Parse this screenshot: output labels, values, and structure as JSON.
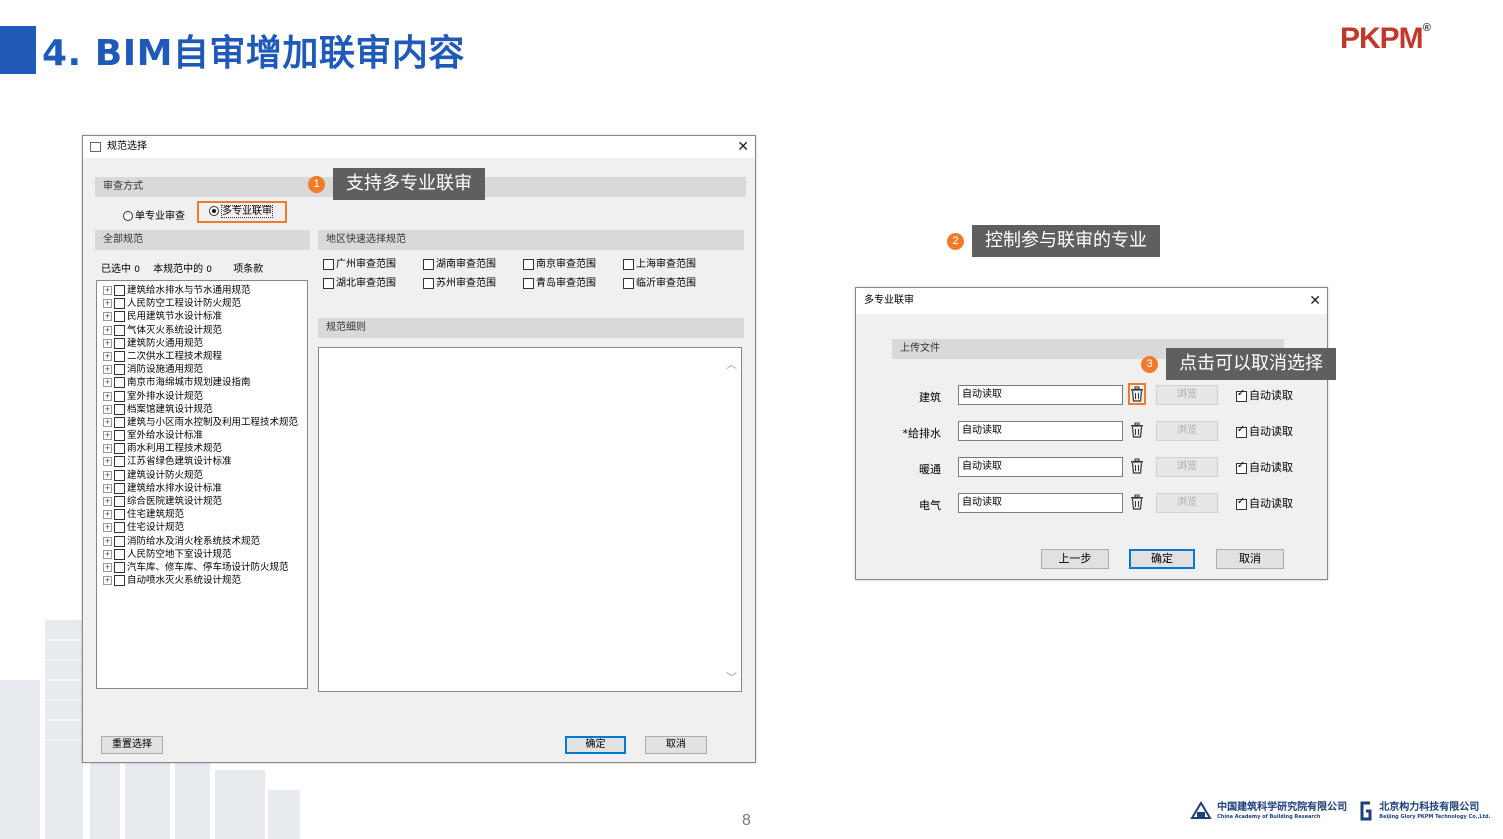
{
  "slide": {
    "title": "4. BIM自审增加联审内容",
    "logo": "PKPM",
    "logo_reg": "®",
    "page_number": "8",
    "footer": {
      "org1_name": "中国建筑科学研究院有限公司",
      "org1_en": "China Academy of Building Research",
      "org2_name": "北京构力科技有限公司",
      "org2_en": "Beijing Glory PKPM Technology Co.,Ltd."
    }
  },
  "callouts": {
    "c1": {
      "badge": "1",
      "text": "支持多专业联审"
    },
    "c2": {
      "badge": "2",
      "text": "控制参与联审的专业"
    },
    "c3": {
      "badge": "3",
      "text": "点击可以取消选择"
    }
  },
  "spec_dialog": {
    "title": "规范选择",
    "review_mode_header": "审查方式",
    "mode_single": "单专业审查",
    "mode_multi": "多专业联审",
    "all_specs_header": "全部规范",
    "selected_label": "已选中",
    "selected_count": "0",
    "in_spec_label": "本规范中的",
    "in_spec_count": "0",
    "items_label": "项条款",
    "specs": [
      "建筑给水排水与节水通用规范",
      "人民防空工程设计防火规范",
      "民用建筑节水设计标准",
      "气体灭火系统设计规范",
      "建筑防火通用规范",
      "二次供水工程技术规程",
      "消防设施通用规范",
      "南京市海绵城市规划建设指南",
      "室外排水设计规范",
      "档案馆建筑设计规范",
      "建筑与小区雨水控制及利用工程技术规范",
      "室外给水设计标准",
      "雨水利用工程技术规范",
      "江苏省绿色建筑设计标准",
      "建筑设计防火规范",
      "建筑给水排水设计标准",
      "综合医院建筑设计规范",
      "住宅建筑规范",
      "住宅设计规范",
      "消防给水及消火栓系统技术规范",
      "人民防空地下室设计规范",
      "汽车库、修车库、停车场设计防火规范",
      "自动喷水灭火系统设计规范"
    ],
    "region_header": "地区快速选择规范",
    "regions": [
      "广州审查范围",
      "湖南审查范围",
      "南京审查范围",
      "上海审查范围",
      "湖北审查范围",
      "苏州审查范围",
      "青岛审查范围",
      "临沂审查范围"
    ],
    "detail_header": "规范细则",
    "reset_button": "重置选择",
    "ok_button": "确定",
    "cancel_button": "取消"
  },
  "multi_dialog": {
    "title": "多专业联审",
    "upload_header": "上传文件",
    "rows": [
      {
        "label": "建筑",
        "value": "自动读取",
        "browse": "浏览",
        "auto": "自动读取"
      },
      {
        "label": "*给排水",
        "value": "自动读取",
        "browse": "浏览",
        "auto": "自动读取"
      },
      {
        "label": "暖通",
        "value": "自动读取",
        "browse": "浏览",
        "auto": "自动读取"
      },
      {
        "label": "电气",
        "value": "自动读取",
        "browse": "浏览",
        "auto": "自动读取"
      }
    ],
    "prev_button": "上一步",
    "ok_button": "确定",
    "cancel_button": "取消"
  },
  "colors": {
    "accent": "#1f5ab8",
    "callout_bg": "#5f5f5f",
    "badge": "#f07b2a",
    "highlight": "#f07b2a"
  }
}
